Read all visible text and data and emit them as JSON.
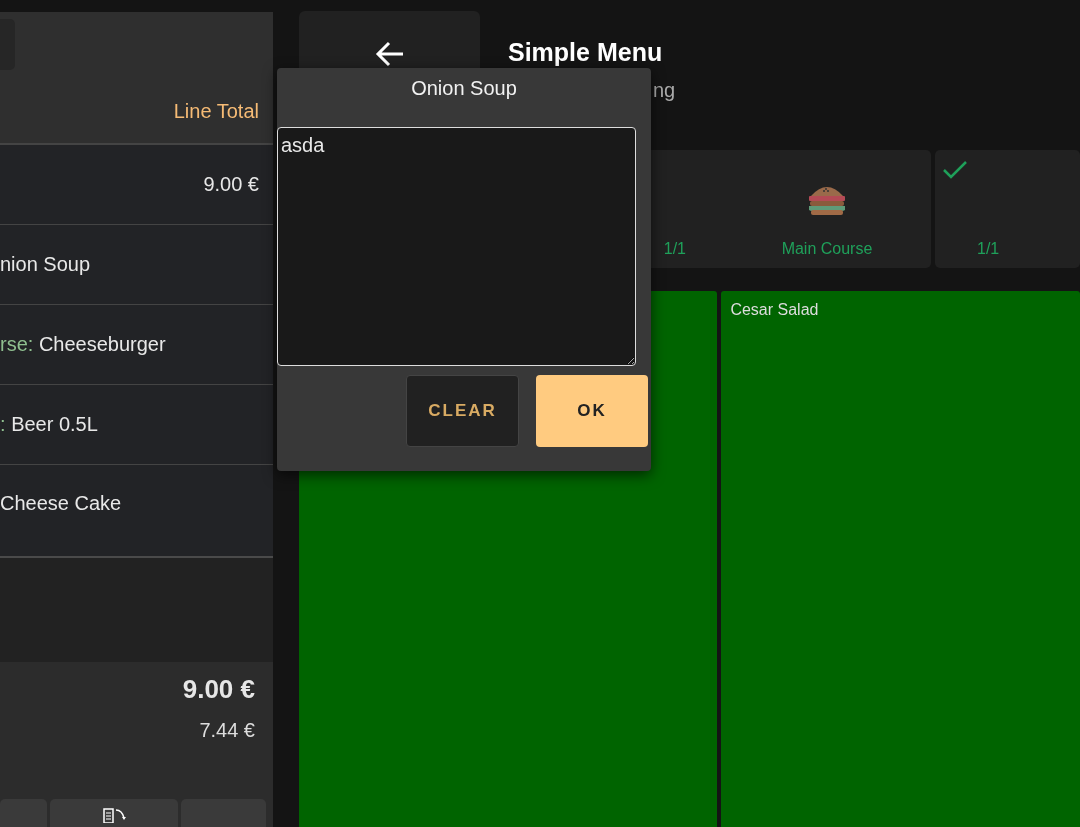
{
  "order": {
    "line_total_label": "Line Total",
    "rows": [
      {
        "price": "9.00 €"
      },
      {
        "name": "nion Soup"
      },
      {
        "course": "rse:",
        "name": "Cheeseburger"
      },
      {
        "course": ":",
        "name": "Beer 0.5L"
      },
      {
        "name": "Cheese Cake"
      }
    ],
    "totals": {
      "total": "9.00 €",
      "net": "7.44 €"
    }
  },
  "menu": {
    "title": "Simple Menu",
    "subtitle": "ng",
    "categories": [
      {
        "count": "1/1",
        "label": "Main Course",
        "checked": false
      },
      {
        "count": "1/1",
        "checked": true
      }
    ],
    "products": [
      {
        "kind": "tile"
      },
      {
        "kind": "tile",
        "name": "Cesar Salad"
      }
    ]
  },
  "dialog": {
    "title": "Onion Soup",
    "note": "asda",
    "buttons": [
      {
        "label": "CLEAR",
        "kind": "secondary"
      },
      {
        "label": "OK",
        "kind": "primary"
      }
    ]
  }
}
